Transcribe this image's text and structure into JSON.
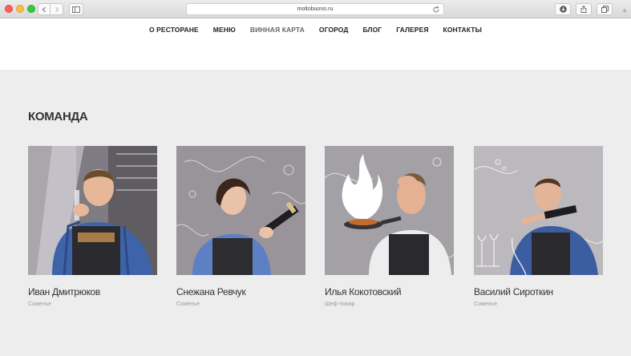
{
  "browser": {
    "url": "moltobuono.ru"
  },
  "menu": [
    {
      "label": "О РЕСТОРАНЕ",
      "active": false
    },
    {
      "label": "МЕНЮ",
      "active": false
    },
    {
      "label": "ВИННАЯ КАРТА",
      "active": true
    },
    {
      "label": "ОГОРОД",
      "active": false
    },
    {
      "label": "БЛОГ",
      "active": false
    },
    {
      "label": "ГАЛЕРЕЯ",
      "active": false
    },
    {
      "label": "КОНТАКТЫ",
      "active": false
    }
  ],
  "team": {
    "title": "КОМАНДА",
    "members": [
      {
        "name": "Иван Дмитрюков",
        "role": "Сомелье"
      },
      {
        "name": "Снежана Ревчук",
        "role": "Сомелье"
      },
      {
        "name": "Илья Кокотовский",
        "role": "Шеф-повар"
      },
      {
        "name": "Василий Сироткин",
        "role": "Сомелье"
      }
    ]
  }
}
